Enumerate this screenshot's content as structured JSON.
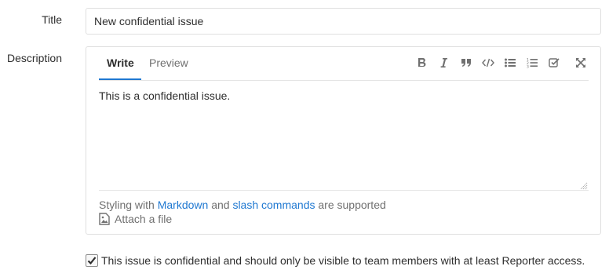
{
  "form": {
    "title_label": "Title",
    "title_value": "New confidential issue",
    "description_label": "Description"
  },
  "editor": {
    "tabs": [
      {
        "label": "Write",
        "active": true
      },
      {
        "label": "Preview",
        "active": false
      }
    ],
    "toolbar": [
      "bold-icon",
      "italic-icon",
      "quote-icon",
      "code-icon",
      "bullet-list-icon",
      "numbered-list-icon",
      "task-list-icon",
      "fullscreen-icon"
    ],
    "content": "This is a confidential issue.",
    "hint_prefix": "Styling with",
    "hint_link_markdown": "Markdown",
    "hint_and": "and",
    "hint_link_slash": "slash commands",
    "hint_suffix": "are supported",
    "attach_label": "Attach a file"
  },
  "confidential": {
    "checked": true,
    "label": "This issue is confidential and should only be visible to team members with at least Reporter access."
  },
  "colors": {
    "link": "#1f78d1",
    "text": "#2e2e2e",
    "muted": "#707070",
    "border": "#dfdfdf"
  }
}
